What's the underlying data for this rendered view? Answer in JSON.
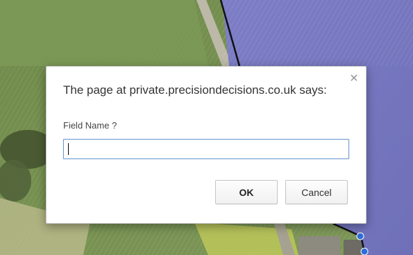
{
  "dialog": {
    "title": "The page at private.precisiondecisions.co.uk says:",
    "close_symbol": "×",
    "prompt_label": "Field Name ?",
    "input_value": "",
    "ok_label": "OK",
    "cancel_label": "Cancel"
  },
  "icons": {
    "close": "close-icon"
  },
  "colors": {
    "field_overlay": "#7878c0",
    "boundary_line": "#111111",
    "vertex_marker": "#2f6ed8"
  }
}
